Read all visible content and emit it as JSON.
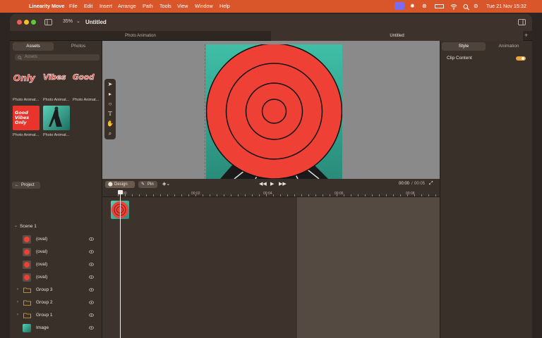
{
  "menubar": {
    "app_name": "Linearity Move",
    "menus": [
      "File",
      "Edit",
      "Insert",
      "Arrange",
      "Path",
      "Tools",
      "View",
      "Window",
      "Help"
    ],
    "datetime": "Tue 21 Nov  15:32"
  },
  "titlebar": {
    "zoom": "35%",
    "title": "Untitled"
  },
  "doc_tabs": [
    "Photo Animation",
    "Untitled"
  ],
  "left_panel": {
    "tabs": [
      "Assets",
      "Photos"
    ],
    "search_placeholder": "Assets",
    "assets": [
      {
        "word": "Only",
        "caption": "Photo Animat..."
      },
      {
        "word": "Vibes",
        "caption": "Photo Animat..."
      },
      {
        "word": "Good",
        "caption": "Photo Animat..."
      },
      {
        "word": "Good Vibes Only",
        "caption": "Photo Animat..."
      },
      {
        "word": "",
        "caption": "Photo Animat..."
      }
    ],
    "project_button": "Project",
    "scene_label": "Scene 1",
    "layers": [
      {
        "name": "(oval)",
        "type": "oval"
      },
      {
        "name": "(oval)",
        "type": "oval"
      },
      {
        "name": "(oval)",
        "type": "oval"
      },
      {
        "name": "(oval)",
        "type": "oval"
      },
      {
        "name": "Group 3",
        "type": "group"
      },
      {
        "name": "Group 2",
        "type": "group"
      },
      {
        "name": "Group 1",
        "type": "group"
      },
      {
        "name": "Image",
        "type": "image"
      }
    ]
  },
  "timeline": {
    "design_button": "Design",
    "pin_button": "Pin",
    "time_current": "00:00",
    "time_total": "00:05",
    "ruler_labels": [
      "00:00",
      "00:02",
      "00:04",
      "00:06",
      "00:08"
    ]
  },
  "right_panel": {
    "tabs": [
      "Style",
      "Animation"
    ],
    "clip_content_label": "Clip Content",
    "clip_content_on": true
  },
  "colors": {
    "menubar": "#d9562a",
    "target_red": "#ef4036",
    "teal": "#3fbfa6",
    "accent_orange": "#e8a33d"
  }
}
